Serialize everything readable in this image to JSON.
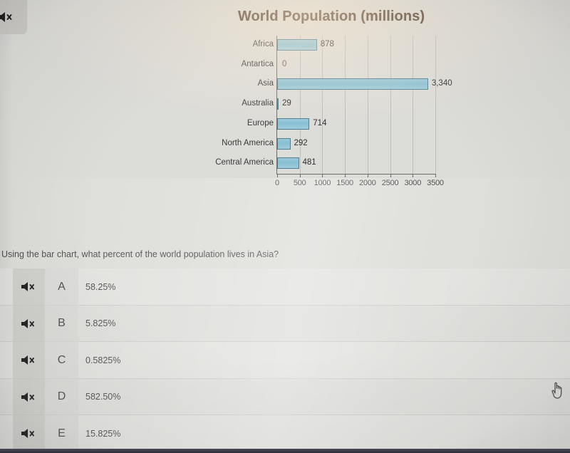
{
  "chart_data": {
    "type": "bar",
    "orientation": "horizontal",
    "title": "World Population (millions)",
    "xlabel": "",
    "ylabel": "",
    "categories": [
      "Africa",
      "Antartica",
      "Asia",
      "Australia",
      "Europe",
      "North America",
      "Central America"
    ],
    "values": [
      878,
      0,
      3340,
      29,
      714,
      292,
      481
    ],
    "value_labels": [
      "878",
      "0",
      "3,340",
      "29",
      "714",
      "292",
      "481"
    ],
    "xticks": [
      0,
      500,
      1000,
      1500,
      2000,
      2500,
      3000,
      3500
    ],
    "xtick_labels": [
      "0",
      "500",
      "1000",
      "1500",
      "2000",
      "2500",
      "3000",
      "3500"
    ],
    "xlim": [
      0,
      3500
    ],
    "grid": true,
    "legend": false,
    "bar_fill": "#92c5d6",
    "bar_border": "#4f7f92",
    "title_color": "#4a3526",
    "zero_label_color": "#8a4f3c"
  },
  "top_bar": {
    "mute_icon": "muted-speaker-icon"
  },
  "question": {
    "text": "Using the bar chart, what percent of the world population lives in Asia?"
  },
  "options": [
    {
      "letter": "A",
      "text": "58.25%",
      "mute_icon": "muted-speaker-icon"
    },
    {
      "letter": "B",
      "text": "5.825%",
      "mute_icon": "muted-speaker-icon"
    },
    {
      "letter": "C",
      "text": "0.5825%",
      "mute_icon": "muted-speaker-icon"
    },
    {
      "letter": "D",
      "text": "582.50%",
      "mute_icon": "muted-speaker-icon"
    },
    {
      "letter": "E",
      "text": "15.825%",
      "mute_icon": "muted-speaker-icon"
    }
  ],
  "cursor": {
    "icon": "pointing-hand-cursor"
  }
}
